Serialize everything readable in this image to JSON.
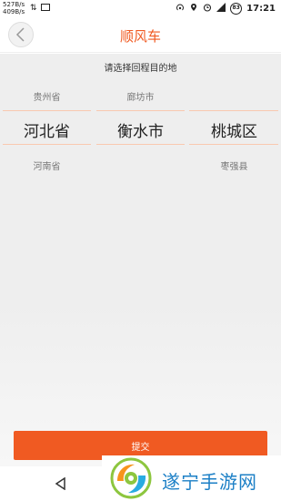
{
  "status_bar": {
    "speed_up": "527B/s",
    "speed_down": "409B/s",
    "time": "17:21",
    "lte": "LTE",
    "battery": "83"
  },
  "header": {
    "title": "顺风车"
  },
  "picker": {
    "prompt": "请选择回程目的地",
    "row_above": [
      "贵州省",
      "廊坊市",
      ""
    ],
    "selected": [
      "河北省",
      "衡水市",
      "桃城区"
    ],
    "row_below": [
      "河南省",
      "",
      "枣强县"
    ]
  },
  "submit_label": "提交",
  "watermark": {
    "text": "遂宁手游网"
  },
  "colors": {
    "accent": "#f05a22",
    "background": "#eeeeee",
    "watermark_blue": "#1b7fc6"
  }
}
